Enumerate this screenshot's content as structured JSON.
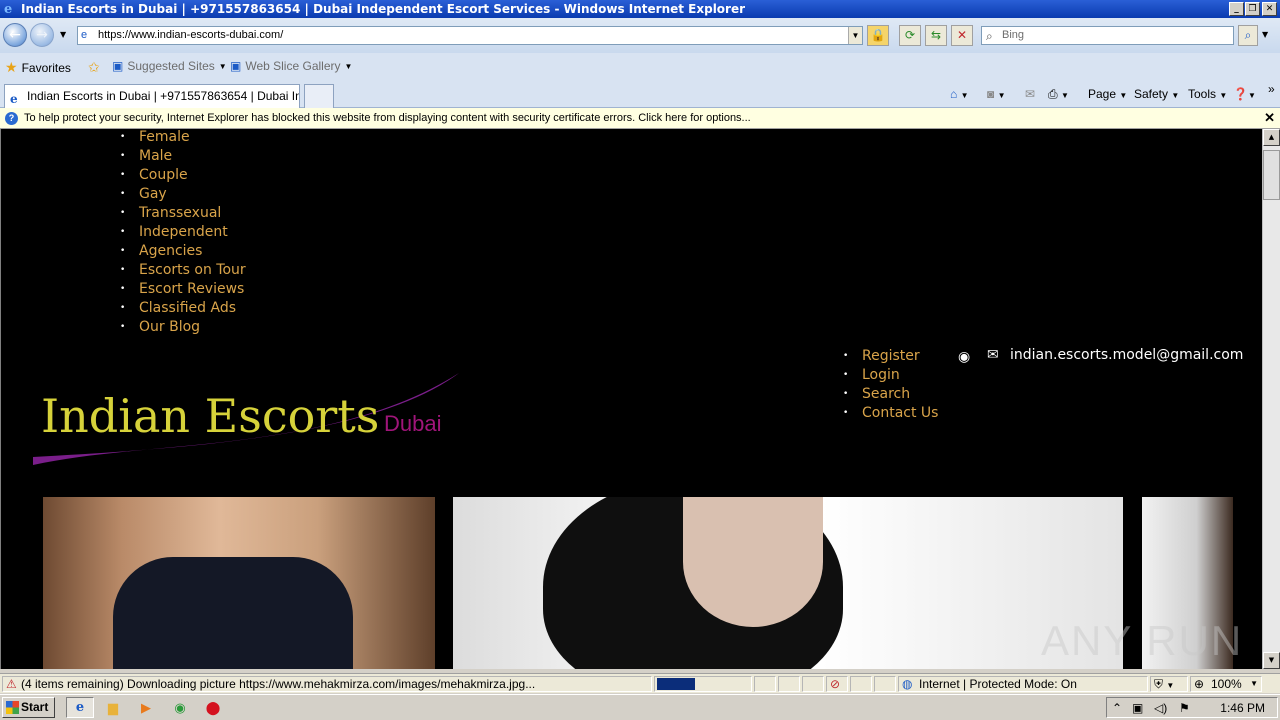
{
  "window": {
    "title": "Indian Escorts in Dubai | +971557863654 | Dubai Independent Escort Services - Windows Internet Explorer",
    "minimize": "_",
    "restore": "❐",
    "close": "✕"
  },
  "toolbar": {
    "url": "https://www.indian-escorts-dubai.com/",
    "search_placeholder": "Bing"
  },
  "favorites_bar": {
    "favorites_label": "Favorites",
    "suggested_sites_label": "Suggested Sites",
    "web_slice_label": "Web Slice Gallery"
  },
  "tab": {
    "title": "Indian Escorts in Dubai | +971557863654 | Dubai Ind..."
  },
  "commands": {
    "page": "Page",
    "safety": "Safety",
    "tools": "Tools"
  },
  "infobar": {
    "message": "To help protect your security, Internet Explorer has blocked this website from displaying content with security certificate errors. Click here for options..."
  },
  "site": {
    "main_menu": [
      "Female",
      "Male",
      "Couple",
      "Gay",
      "Transsexual",
      "Independent",
      "Agencies",
      "Escorts on Tour",
      "Escort Reviews",
      "Classified Ads",
      "Our Blog"
    ],
    "account_menu": [
      "Register",
      "Login",
      "Search",
      "Contact Us"
    ],
    "email": "indian.escorts.model@gmail.com",
    "logo_main": "Indian Escorts",
    "logo_sub": "Dubai",
    "watermark": "ANY RUN"
  },
  "statusbar": {
    "text": "(4 items remaining) Downloading picture https://www.mehakmirza.com/images/mehakmirza.jpg...",
    "zone": "Internet | Protected Mode: On",
    "zoom": "100%"
  },
  "taskbar": {
    "start_label": "Start",
    "clock": "1:46 PM"
  },
  "colors": {
    "menu_link": "#d9a44a",
    "logo_yellow": "#d6d23a",
    "logo_purple": "#a0157a",
    "page_bg": "#000000"
  }
}
